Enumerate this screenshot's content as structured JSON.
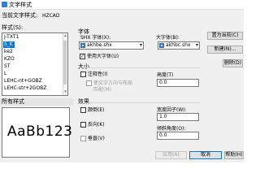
{
  "window": {
    "title": "文字样式"
  },
  "current_style": {
    "label": "当前文字样式:",
    "value": "HZCAD"
  },
  "styles": {
    "label": "样式(S):",
    "items": [
      "J-TXT1",
      "S_K",
      "ke2",
      "KZO",
      "ST",
      "L",
      "LEHC-nt+GOBZ",
      "LEHC-str+2GOBZ"
    ],
    "selected_index": 1
  },
  "preview": {
    "label": "所有样式",
    "sample": "AaBb123"
  },
  "font": {
    "group_label": "字体",
    "shx_label": "SHX 字体(X):",
    "shx_value": "akhbe.shx",
    "big_label": "大字体(B):",
    "big_value": "akhbc.shx",
    "use_bigfont_label": "使用大字体(U)",
    "use_bigfont_checked": true
  },
  "size": {
    "group_label": "大小",
    "annotative_label": "注释性(I)",
    "annotative_checked": false,
    "match_orientation_label": "使文字方向与布局",
    "match_orientation_label2": "匹配(M)",
    "height_label": "高度(T)",
    "height_value": "0.0"
  },
  "effects": {
    "group_label": "效果",
    "upside_down_label": "颠倒(E)",
    "backwards_label": "反向(K)",
    "vertical_label": "垂直(V)",
    "width_factor_label": "宽度因子(W):",
    "width_factor_value": "1.0",
    "oblique_label": "倾斜角度(O):",
    "oblique_value": "0.0"
  },
  "buttons": {
    "set_current": "置为当前(C)",
    "new": "新建(N)...",
    "delete": "删除(D)",
    "apply": "应用(A)",
    "cancel": "取消",
    "help": "帮助(H)"
  },
  "symbols": {
    "check": "✓",
    "dropdown": "▾",
    "scroll_up": "▴",
    "scroll_down": "▾"
  }
}
